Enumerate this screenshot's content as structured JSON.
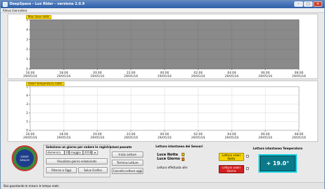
{
  "window": {
    "title": "DeepSpace - Lux Rider - versione 2.0.9",
    "min_glyph": "–",
    "max_glyph": "□",
    "close_glyph": "✕"
  },
  "menu": {
    "file": "Rilevo Giornaliero"
  },
  "chart_top": {
    "badge": "Max lluxe notte",
    "yticks": [
      "5",
      "4",
      "3",
      "2",
      "1",
      "0"
    ],
    "xtimes": [
      "16:00",
      "18:00",
      "20:00",
      "22:00",
      "00:00",
      "02:00",
      "04:00",
      "06:00",
      "08:00"
    ],
    "xdates": [
      "29/05/16",
      "29/05/16",
      "29/05/16",
      "29/05/16",
      "29/05/16",
      "29/05/16",
      "29/05/16",
      "29/05/16",
      "29/05/16"
    ]
  },
  "chart_bottom": {
    "badge": "Valori temperatura notte",
    "yticks": [
      "5",
      "4",
      "3",
      "2",
      "1",
      "0"
    ],
    "xtimes": [
      "16:00",
      "18:00",
      "20:00",
      "22:00",
      "00:00",
      "02:00",
      "04:00",
      "06:00",
      "08:00"
    ],
    "xdates": [
      "29/05/16",
      "29/05/16",
      "29/05/16",
      "29/05/16",
      "29/05/16",
      "29/05/16",
      "29/05/16",
      "29/05/16",
      "29/05/16"
    ]
  },
  "chart_data": [
    {
      "type": "area",
      "title": "Max lluxe notte",
      "ylim": [
        0,
        5
      ],
      "x": [
        "16:00",
        "18:00",
        "20:00",
        "22:00",
        "00:00",
        "02:00",
        "04:00",
        "06:00",
        "08:00"
      ],
      "series": [],
      "grid": true
    },
    {
      "type": "scatter",
      "title": "Valori temperatura notte",
      "ylim": [
        0,
        5
      ],
      "x": [
        "16:00",
        "18:00",
        "20:00",
        "22:00",
        "00:00",
        "02:00",
        "04:00",
        "06:00",
        "08:00"
      ],
      "series": [],
      "grid": true
    }
  ],
  "logo": {
    "line1": "DEEP",
    "line2": "SPACE"
  },
  "selection": {
    "header": "Seleziona un giorno per vedere le registrazioni passate",
    "day_value": "domenica",
    "day_num": "29",
    "month": "maggio",
    "year": "2016",
    "view_button": "Visualizza giorno selezionato",
    "today_button": "Ritorna a Oggi",
    "save_button": "Salva Grafico"
  },
  "actions": {
    "start_button": "Inizia Letture",
    "stop_button": "Termina Letture",
    "delete_button": "Cancella Letture oggi"
  },
  "sensors": {
    "header": "Lettura istantanea dei Sensori",
    "night_label": "Luce Notte",
    "day_label": "Luce Giorno",
    "last_read_label": "Lettura effettuata alle:",
    "last_read_value": ""
  },
  "night_button": "Lettura valori Notte",
  "day_button": "Lettura valori Giorno",
  "temperature": {
    "header": "Lettura istantanea Temperatura",
    "value": "+ 19.0°"
  },
  "status": {
    "text": "Stai guardando le misure in tempo reale"
  },
  "colors": {
    "chart_top_bg": "#8a8a8a",
    "badge": "#ffd700",
    "temp_bg": "#0a7a8a",
    "temp_border": "#0fd0e0",
    "night_btn": "#f5d300",
    "day_btn": "#d41f1f",
    "title_bar": "#2e5fa8"
  }
}
